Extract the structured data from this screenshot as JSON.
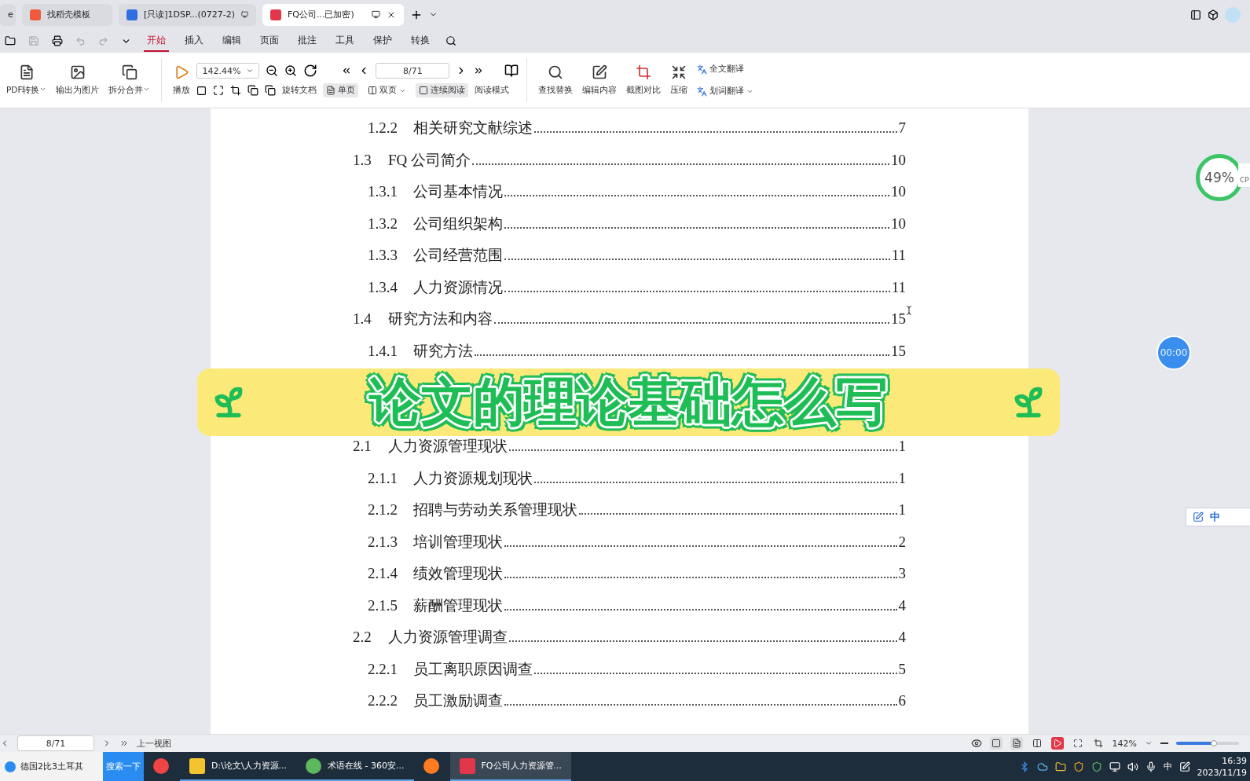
{
  "browser_tabs": [
    {
      "label": "e",
      "kind": "cut",
      "selected": false
    },
    {
      "label": "找稻壳模板",
      "kind": "docer",
      "selected": false
    },
    {
      "label": "[只读]1DSP...(0727-2)",
      "kind": "word",
      "selected": false
    },
    {
      "label": "FQ公司...已加密)",
      "kind": "pdf",
      "selected": true
    }
  ],
  "menu": [
    {
      "label": "开始",
      "selected": true
    },
    {
      "label": "插入",
      "selected": false
    },
    {
      "label": "编辑",
      "selected": false
    },
    {
      "label": "页面",
      "selected": false
    },
    {
      "label": "批注",
      "selected": false
    },
    {
      "label": "工具",
      "selected": false
    },
    {
      "label": "保护",
      "selected": false
    },
    {
      "label": "转换",
      "selected": false
    }
  ],
  "toolbar": {
    "convert_buttons": [
      {
        "label": "PDF转换",
        "has_menu": true
      },
      {
        "label": "输出为图片",
        "has_menu": false
      },
      {
        "label": "拆分合并",
        "has_menu": true
      }
    ],
    "play_label": "播放",
    "zoom_value": "142.44%",
    "page_value": "8/71",
    "rotate_label": "旋转文档",
    "view_buttons": [
      {
        "label": "单页",
        "selected": true,
        "has_menu": false
      },
      {
        "label": "双页",
        "selected": false,
        "has_menu": true
      },
      {
        "label": "连续阅读",
        "selected": true,
        "has_menu": false
      }
    ],
    "reading_mode_label": "阅读模式",
    "tool_buttons": [
      {
        "label": "查找替换"
      },
      {
        "label": "编辑内容"
      },
      {
        "label": "截图对比"
      },
      {
        "label": "压缩"
      }
    ],
    "translate_buttons": [
      {
        "label": "全文翻译",
        "has_menu": false
      },
      {
        "label": "划词翻译",
        "has_menu": true
      }
    ]
  },
  "toc_continued": [
    {
      "number": "1.2.2",
      "title": "相关研究文献综述",
      "page": "7"
    }
  ],
  "toc": [
    {
      "number": "1.3",
      "title": "FQ 公司简介",
      "page": "10",
      "children": [
        {
          "number": "1.3.1",
          "title": "公司基本情况",
          "page": "10"
        },
        {
          "number": "1.3.2",
          "title": "公司组织架构",
          "page": "10"
        },
        {
          "number": "1.3.3",
          "title": "公司经营范围",
          "page": "11"
        },
        {
          "number": "1.3.4",
          "title": "人力资源情况",
          "page": "11"
        }
      ]
    },
    {
      "number": "1.4",
      "title": "研究方法和内容",
      "page": "15",
      "children": [
        {
          "number": "1.4.1",
          "title": "研究方法",
          "page": "15"
        }
      ]
    },
    {
      "number": "2.1",
      "title": "人力资源管理现状",
      "page": "1",
      "children": [
        {
          "number": "2.1.1",
          "title": "人力资源规划现状",
          "page": "1"
        },
        {
          "number": "2.1.2",
          "title": "招聘与劳动关系管理现状",
          "page": "1"
        },
        {
          "number": "2.1.3",
          "title": "培训管理现状",
          "page": "2"
        },
        {
          "number": "2.1.4",
          "title": "绩效管理现状",
          "page": "3"
        },
        {
          "number": "2.1.5",
          "title": "薪酬管理现状",
          "page": "4"
        }
      ]
    },
    {
      "number": "2.2",
      "title": "人力资源管理调查",
      "page": "4",
      "children": [
        {
          "number": "2.2.1",
          "title": "员工离职原因调查",
          "page": "5"
        },
        {
          "number": "2.2.2",
          "title": "员工激励调查",
          "page": "6"
        }
      ]
    }
  ],
  "banner": {
    "title": "论文的理论基础怎么写"
  },
  "widgets": {
    "cpu_value": "49%",
    "cpu_label": "CP",
    "timer": "00:00",
    "ime_label": "中"
  },
  "status_bar": {
    "page_value": "8/71",
    "back_label": "上一视图",
    "zoom_value": "142%",
    "zoom_slider": {
      "level": 0.6
    }
  },
  "taskbar": {
    "search_value": "德国2比3土耳其",
    "search_button": "搜索一下",
    "apps": [
      {
        "kind": "chrome",
        "selected": false
      },
      {
        "kind": "folder",
        "label": "D:\\论文\\人力资源...",
        "selected": false
      },
      {
        "kind": "browser360",
        "label": "术语在线 - 360安...",
        "selected": false
      },
      {
        "kind": "firefox",
        "selected": false
      },
      {
        "kind": "wps",
        "label": "FQ公司人力资源管...",
        "selected": true
      }
    ],
    "ime": "中",
    "time": "16:39",
    "date": "2023/11/19"
  }
}
